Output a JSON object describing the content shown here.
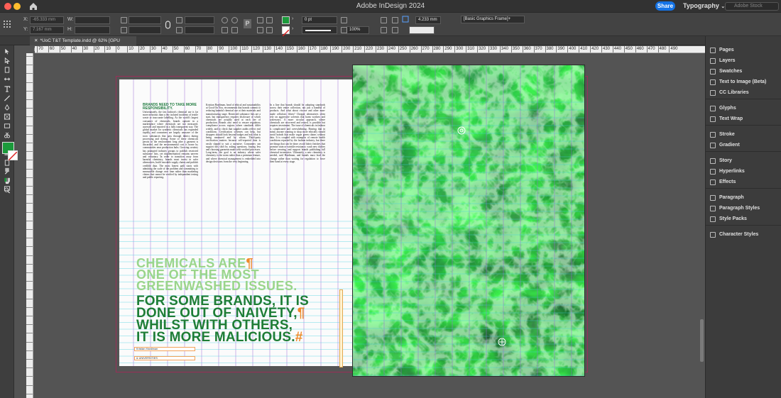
{
  "app": {
    "title": "Adobe InDesign 2024",
    "share_label": "Share",
    "workspace_label": "Typography",
    "stock_search_placeholder": "Adobe Stock"
  },
  "control_bar": {
    "x_label": "X:",
    "y_label": "Y:",
    "w_label": "W:",
    "h_label": "H:",
    "x_value": "-65.333 mm",
    "y_value": "7.167 mm",
    "stroke_weight": "0 pt",
    "scale": "100%",
    "ref_value": "4.233 mm",
    "object_style": "[Basic Graphics Frame]+",
    "fill_color": "#1b9a3b",
    "accent": "#1473e6"
  },
  "document": {
    "tab_label": "*UoC T&T Template.indd @ 62% [GPU Preview]"
  },
  "rulers": {
    "horizontal_ticks": [
      "70",
      "60",
      "50",
      "40",
      "30",
      "20",
      "10",
      "0",
      "10",
      "20",
      "30",
      "40",
      "50",
      "60",
      "70",
      "80",
      "90",
      "100",
      "110",
      "120",
      "130",
      "140",
      "150",
      "160",
      "170",
      "180",
      "190",
      "200",
      "210",
      "220",
      "230",
      "240",
      "250",
      "260",
      "270",
      "280",
      "290",
      "300",
      "310",
      "320",
      "330",
      "340",
      "350",
      "360",
      "370",
      "380",
      "390",
      "400",
      "410",
      "420",
      "430",
      "440",
      "450",
      "460",
      "470",
      "480",
      "490"
    ]
  },
  "spread": {
    "intro_head": "BRANDS NEED TO TAKE MORE RESPONSIBILITY.",
    "col1_text": "Unfortunately, the fast fashion's chemical use is far more nefarious than a few isolated incidents of textile waste or inaccurate labelling. As the world's largest consumer of chemicals, brands operate in a marketplace where chemicals are not measured, assessed and reported in a fully transparent way. The global market for synthetic chemicals has expanded rapidly, and consumers are largely unaware of the toxic substances that pass through fabrics during processing and dyeing. Some of these chemicals persist in the environment long after a garment is discarded, and the environmental cost is borne by communities near production hubs. Growing scrutiny has prompted industry groups to publish restricted substance lists, yet implementation remains uneven and voluntary. In order to transition away from harmful chemistry, brands must invest in safer alternatives, build traceable supply chains and publish credible data. The most honest path starts with admitting the scale of the problem and committing to measurable change over time rather than marketing claims that cannot be verified by independent testing and public reporting.",
    "col2_text": "Kristian Hardiman, head of ethical and sustainability at Good On You, recommends that brands commit to reducing harmful chemical use at their materials and manufacturing stage. Restricted substance lists are a start, but transparency requires disclosure of which chemicals are actually used at each tier of production. Brands also need to ensure regulatory compliance across regions where standards differ widely, and to check that supplier audits reflect real conditions. Certification schemes can help, but shoppers should look beyond badges and ask what is being measured and by whom. Third-party verification matters because self-reported data is easily shaped to suit a narrative. Consumers can support this shift by asking questions, buying less and choosing garments made with verified processes. Long-term, the goal is an industry where safer chemistry is the norm rather than a premium feature, and where chemical management is embedded into design decisions from the very beginning.",
    "col3_text": "In a line that brands should be adopting standards across their entire collection, not just a handful of products. And what about viscose and other man-made cellulosic fibres? Cheaper alternatives often rely on aggressive solvents that harm workers and waterways. A more circular approach, where chemicals are recovered and reused, is possible but requires investment. The issue of chemicals in fashion is complicated and overwhelming. Bearing that in mind, anyone wanting to shop more ethically should avoid brands that make vague green claims without data. It is coupled with examples of remote health conditions reported by the fashion industry, but there are things that can be done: avoid fabric finishes that promise stain or wrinkle resistance, wash new clothes before wearing, and support brands publishing full chemical inventories. Ultimately, a new chemistry is needed, said Hardiman, and brands must lead the change rather than waiting for regulation to force their hand at every stage.",
    "pull_light": [
      "CHEMICALS ARE",
      "ONE OF THE MOST",
      "GREENWASHED ISSUES."
    ],
    "pull_dark": [
      "FOR SOME BRANDS, IT IS",
      "DONE OUT OF NAIVETY,",
      "WHILST WITH OTHERS,",
      "IT IS MORE MALICIOUS."
    ],
    "pilcrow": "¶",
    "end_mark": "#",
    "byline": "Kristian Hardiman",
    "caption": "& UNIVERSITIES"
  },
  "panels": {
    "items": [
      {
        "label": "Pages",
        "icon": "pages-icon"
      },
      {
        "label": "Layers",
        "icon": "layers-icon"
      },
      {
        "label": "Swatches",
        "icon": "swatches-icon"
      },
      {
        "label": "Text to Image (Beta)",
        "icon": "text-to-image-icon"
      },
      {
        "label": "CC Libraries",
        "icon": "cc-libraries-icon"
      },
      {
        "label": "Glyphs",
        "icon": "glyphs-icon"
      },
      {
        "label": "Text Wrap",
        "icon": "text-wrap-icon"
      },
      {
        "label": "Stroke",
        "icon": "stroke-icon"
      },
      {
        "label": "Gradient",
        "icon": "gradient-icon"
      },
      {
        "label": "Story",
        "icon": "story-icon"
      },
      {
        "label": "Hyperlinks",
        "icon": "hyperlinks-icon"
      },
      {
        "label": "Effects",
        "icon": "effects-icon"
      },
      {
        "label": "Paragraph",
        "icon": "paragraph-icon"
      },
      {
        "label": "Paragraph Styles",
        "icon": "paragraph-styles-icon"
      },
      {
        "label": "Style Packs",
        "icon": "style-packs-icon"
      },
      {
        "label": "Character Styles",
        "icon": "character-styles-icon"
      }
    ]
  }
}
